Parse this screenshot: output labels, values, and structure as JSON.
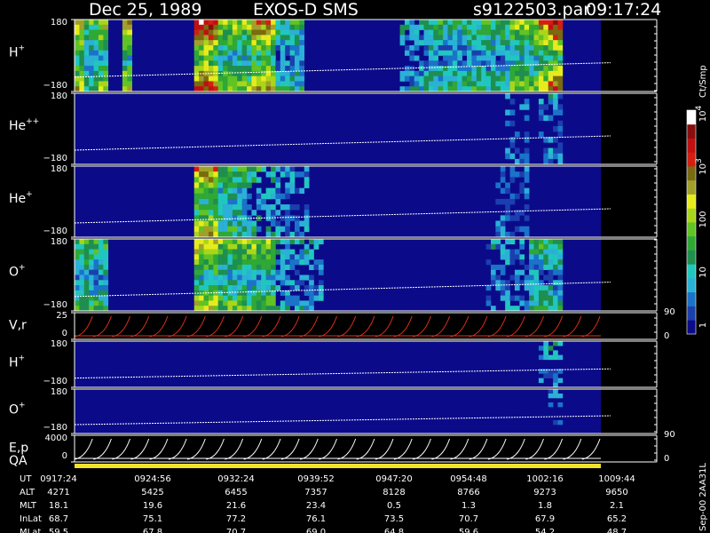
{
  "header": {
    "date": "Dec 25, 1989",
    "instrument": "EXOS-D SMS",
    "file": "s9122503.par",
    "time": "09:17:24"
  },
  "colorbar": {
    "unit": "Ct/Smp",
    "ticks": [
      {
        "label": "1"
      },
      {
        "label": "10"
      },
      {
        "label": "100"
      },
      {
        "label": "10",
        "exp": "3"
      },
      {
        "label": "10",
        "exp": "4"
      }
    ],
    "colors": [
      "#0b0b8a",
      "#1b3fae",
      "#1a73c9",
      "#2bb0d6",
      "#21c7bf",
      "#1e8f4f",
      "#2fa836",
      "#61c324",
      "#a9d61a",
      "#e6ec1c",
      "#a0a02a",
      "#7a6a10",
      "#d41e10",
      "#c01010",
      "#8a0d0d",
      "#ffffff"
    ]
  },
  "panels": [
    {
      "key": "h_plus",
      "species": "H",
      "charge": "+",
      "ymax": "180",
      "ymin": "−180"
    },
    {
      "key": "he_pp",
      "species": "He",
      "charge": "++",
      "ymax": "180",
      "ymin": "−180"
    },
    {
      "key": "he_plus",
      "species": "He",
      "charge": "+",
      "ymax": "180",
      "ymin": "−180"
    },
    {
      "key": "o_plus",
      "species": "O",
      "charge": "+",
      "ymax": "180",
      "ymin": "−180"
    },
    {
      "key": "vr",
      "species": "V,r",
      "charge": "",
      "ymax": "25",
      "ymin": "0",
      "right_max": "90",
      "right_min": "0"
    },
    {
      "key": "h_plus_2",
      "species": "H",
      "charge": "+",
      "ymax": "180",
      "ymin": "−180"
    },
    {
      "key": "o_plus_2",
      "species": "O",
      "charge": "+",
      "ymax": "180",
      "ymin": "−180"
    },
    {
      "key": "ep",
      "species": "E,p",
      "charge": "",
      "ymax": "4000",
      "ymin": "0",
      "right_max": "90",
      "right_min": "0"
    }
  ],
  "qa_label": "QA",
  "side_note": "Sep-00 2AA31L",
  "table": {
    "rows": [
      {
        "label": "UT",
        "values": [
          "0917:24",
          "0924:56",
          "0932:24",
          "0939:52",
          "0947:20",
          "0954:48",
          "1002:16",
          "1009:44"
        ]
      },
      {
        "label": "ALT",
        "values": [
          "4271",
          "5425",
          "6455",
          "7357",
          "8128",
          "8766",
          "9273",
          "9650"
        ]
      },
      {
        "label": "MLT",
        "values": [
          "18.1",
          "19.6",
          "21.6",
          "23.4",
          "0.5",
          "1.3",
          "1.8",
          "2.1"
        ]
      },
      {
        "label": "InLat",
        "values": [
          "68.7",
          "75.1",
          "77.2",
          "76.1",
          "73.5",
          "70.7",
          "67.9",
          "65.2"
        ]
      },
      {
        "label": "MLat",
        "values": [
          "59.5",
          "67.8",
          "70.7",
          "69.0",
          "64.8",
          "59.6",
          "54.2",
          "48.7"
        ]
      }
    ]
  },
  "chart_data": {
    "type": "heatmap",
    "title": "Dec 25, 1989   EXOS-D SMS",
    "x_ticks": [
      "0917:24",
      "0924:56",
      "0932:24",
      "0939:52",
      "0947:20",
      "0954:48",
      "1002:16",
      "1009:44"
    ],
    "colorbar_label": "Ct/Smp",
    "colorbar_scale": "log",
    "colorbar_range": [
      1,
      10000
    ],
    "series": [
      {
        "name": "H+",
        "ylim": [
          -180,
          180
        ]
      },
      {
        "name": "He++",
        "ylim": [
          -180,
          180
        ]
      },
      {
        "name": "He+",
        "ylim": [
          -180,
          180
        ]
      },
      {
        "name": "O+",
        "ylim": [
          -180,
          180
        ]
      },
      {
        "name": "V,r",
        "ylim": [
          0,
          25
        ],
        "ylim_right": [
          0,
          90
        ]
      },
      {
        "name": "H+",
        "ylim": [
          -180,
          180
        ]
      },
      {
        "name": "O+",
        "ylim": [
          -180,
          180
        ]
      },
      {
        "name": "E,p",
        "ylim": [
          0,
          4000
        ],
        "ylim_right": [
          0,
          90
        ]
      }
    ]
  }
}
